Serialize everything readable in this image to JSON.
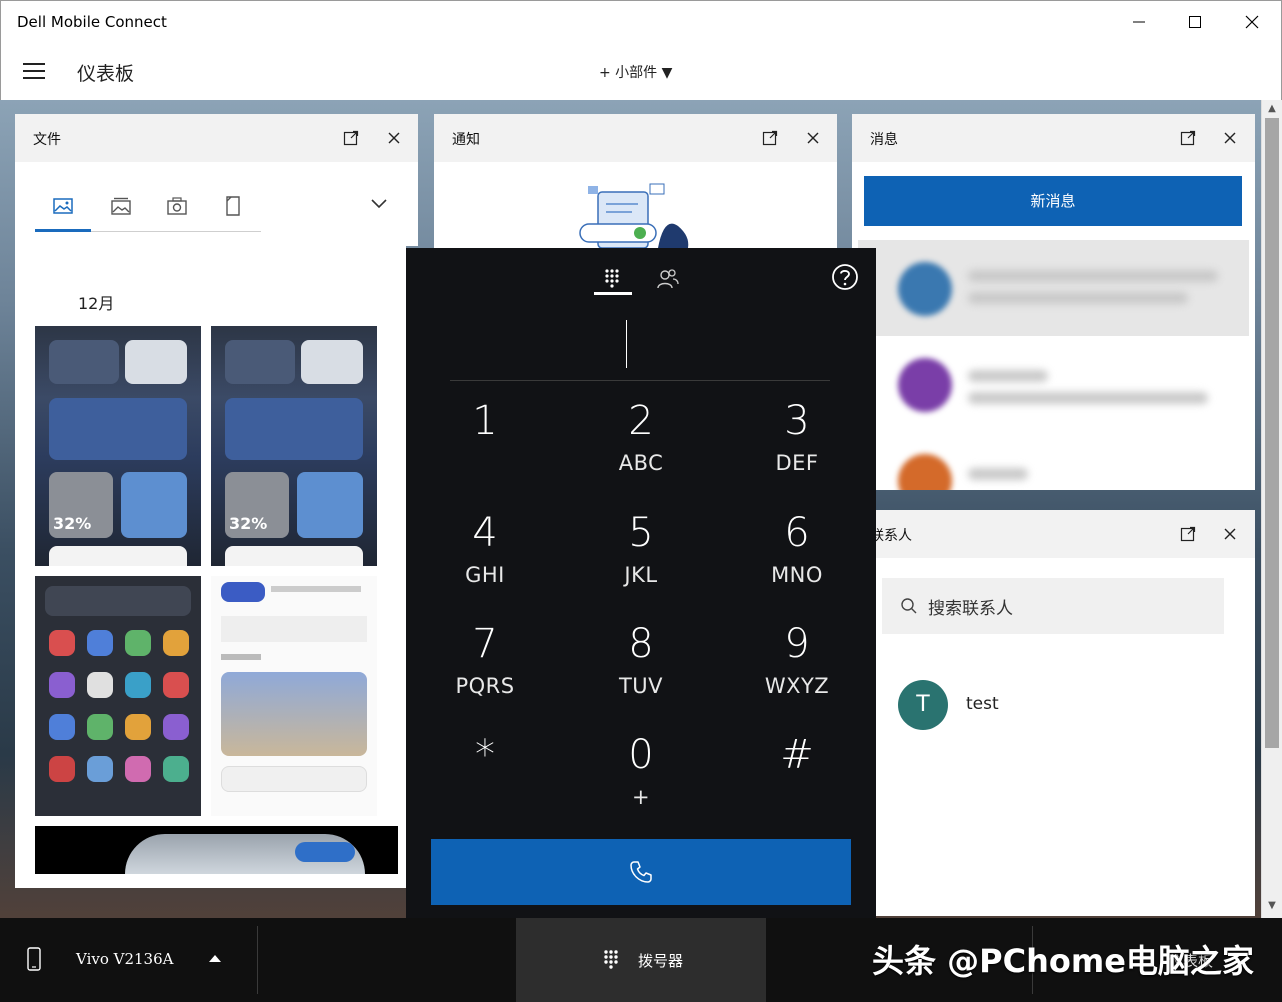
{
  "window": {
    "title": "Dell Mobile Connect"
  },
  "header": {
    "page_title": "仪表板",
    "widgets_button": "+ 小部件 ▼"
  },
  "files": {
    "title": "文件",
    "month": "12月",
    "thumb_percent": "32%"
  },
  "notifications": {
    "title": "通知"
  },
  "messages": {
    "title": "消息",
    "new_message": "新消息"
  },
  "contacts": {
    "title": "联系人",
    "search_placeholder": "搜索联系人",
    "items": [
      {
        "initial": "T",
        "name": "test"
      }
    ]
  },
  "dialer": {
    "keys": [
      {
        "digit": "1",
        "letters": ""
      },
      {
        "digit": "2",
        "letters": "ABC"
      },
      {
        "digit": "3",
        "letters": "DEF"
      },
      {
        "digit": "4",
        "letters": "GHI"
      },
      {
        "digit": "5",
        "letters": "JKL"
      },
      {
        "digit": "6",
        "letters": "MNO"
      },
      {
        "digit": "7",
        "letters": "PQRS"
      },
      {
        "digit": "8",
        "letters": "TUV"
      },
      {
        "digit": "9",
        "letters": "WXYZ"
      },
      {
        "digit": "*",
        "letters": ""
      },
      {
        "digit": "0",
        "letters": "+"
      },
      {
        "digit": "#",
        "letters": ""
      }
    ]
  },
  "bottombar": {
    "device_name": "Vivo V2136A",
    "dialer_label": "拨号器",
    "dashboard_label": "仪表板"
  },
  "watermark": "头条 @PChome电脑之家",
  "colors": {
    "accent": "#0e62b4",
    "avatar": "#2a7370",
    "dialer_bg": "#111215"
  }
}
